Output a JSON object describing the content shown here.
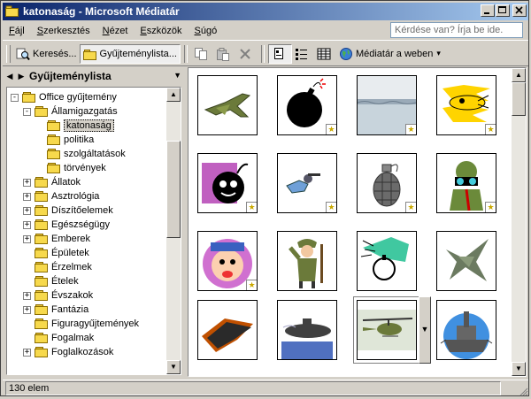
{
  "window": {
    "title": "katonaság - Microsoft Médiatár"
  },
  "menubar": {
    "items": [
      {
        "label": "Fájl",
        "accel_index": 0
      },
      {
        "label": "Szerkesztés",
        "accel_index": 0
      },
      {
        "label": "Nézet",
        "accel_index": 0
      },
      {
        "label": "Eszközök",
        "accel_index": 0
      },
      {
        "label": "Súgó",
        "accel_index": 0
      }
    ],
    "help_placeholder": "Kérdése van? Írja be ide."
  },
  "toolbar": {
    "search_label": "Keresés...",
    "collections_label": "Gyűjteménylista...",
    "web_label": "Médiatár a weben"
  },
  "left_panel": {
    "title": "Gyűjteménylista",
    "tree": [
      {
        "label": "Office gyűjtemény",
        "level": 0,
        "expander": "-"
      },
      {
        "label": "Államigazgatás",
        "level": 1,
        "expander": "-"
      },
      {
        "label": "katonaság",
        "level": 2,
        "expander": "",
        "selected": true
      },
      {
        "label": "politika",
        "level": 2,
        "expander": ""
      },
      {
        "label": "szolgáltatások",
        "level": 2,
        "expander": ""
      },
      {
        "label": "törvények",
        "level": 2,
        "expander": ""
      },
      {
        "label": "Állatok",
        "level": 1,
        "expander": "+"
      },
      {
        "label": "Asztrológia",
        "level": 1,
        "expander": "+"
      },
      {
        "label": "Díszítőelemek",
        "level": 1,
        "expander": "+"
      },
      {
        "label": "Egészségügy",
        "level": 1,
        "expander": "+"
      },
      {
        "label": "Emberek",
        "level": 1,
        "expander": "+"
      },
      {
        "label": "Épületek",
        "level": 1,
        "expander": ""
      },
      {
        "label": "Érzelmek",
        "level": 1,
        "expander": ""
      },
      {
        "label": "Ételek",
        "level": 1,
        "expander": ""
      },
      {
        "label": "Évszakok",
        "level": 1,
        "expander": "+"
      },
      {
        "label": "Fantázia",
        "level": 1,
        "expander": "+"
      },
      {
        "label": "Figuragyűjtemények",
        "level": 1,
        "expander": ""
      },
      {
        "label": "Fogalmak",
        "level": 1,
        "expander": ""
      },
      {
        "label": "Foglalkozások",
        "level": 1,
        "expander": "+"
      }
    ]
  },
  "gallery": {
    "items": [
      {
        "name": "jet-fighter-clipart",
        "motion": false
      },
      {
        "name": "bomb-clipart",
        "motion": true
      },
      {
        "name": "water-photo",
        "motion": true
      },
      {
        "name": "missile-clipart",
        "motion": true
      },
      {
        "name": "cartoon-bomb-clipart",
        "motion": true
      },
      {
        "name": "soldier-crawling-clipart",
        "motion": true
      },
      {
        "name": "grenade-clipart",
        "motion": true
      },
      {
        "name": "soldier-binoculars-clipart",
        "motion": true
      },
      {
        "name": "cartoon-face-clipart",
        "motion": true
      },
      {
        "name": "saluting-soldier-clipart",
        "motion": false
      },
      {
        "name": "bomb-drop-clipart",
        "motion": false
      },
      {
        "name": "fighter-jet-topview-clipart",
        "motion": false
      },
      {
        "name": "stealth-plane-clipart",
        "motion": false
      },
      {
        "name": "submarine-clipart",
        "motion": false
      },
      {
        "name": "helicopter-photo",
        "motion": false,
        "selected": true
      },
      {
        "name": "battleship-clipart",
        "motion": false
      }
    ]
  },
  "statusbar": {
    "text": "130 elem"
  },
  "colors": {
    "titlebar_start": "#0a246a",
    "titlebar_end": "#a6caf0",
    "chrome": "#d4d0c8",
    "folder": "#f7d94c"
  }
}
